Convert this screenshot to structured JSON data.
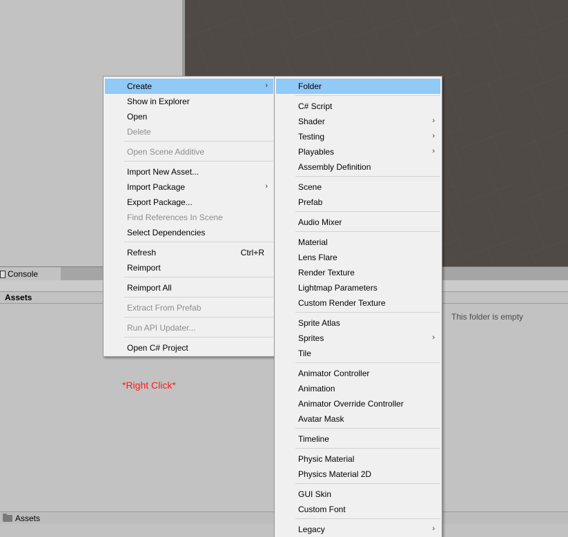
{
  "console_tab": {
    "label": "Console"
  },
  "assets": {
    "header": "Assets",
    "empty_message": "This folder is empty",
    "breadcrumb": "Assets"
  },
  "annotation": "*Right Click*",
  "context_menu": {
    "items": [
      {
        "label": "Create",
        "shortcut": "",
        "submenu": true,
        "disabled": false,
        "highlighted": true
      },
      {
        "label": "Show in Explorer",
        "shortcut": "",
        "submenu": false,
        "disabled": false
      },
      {
        "label": "Open",
        "shortcut": "",
        "submenu": false,
        "disabled": false
      },
      {
        "label": "Delete",
        "shortcut": "",
        "submenu": false,
        "disabled": true
      },
      {
        "label": "Open Scene Additive",
        "shortcut": "",
        "submenu": false,
        "disabled": true
      },
      {
        "label": "Import New Asset...",
        "shortcut": "",
        "submenu": false,
        "disabled": false
      },
      {
        "label": "Import Package",
        "shortcut": "",
        "submenu": true,
        "disabled": false
      },
      {
        "label": "Export Package...",
        "shortcut": "",
        "submenu": false,
        "disabled": false
      },
      {
        "label": "Find References In Scene",
        "shortcut": "",
        "submenu": false,
        "disabled": true
      },
      {
        "label": "Select Dependencies",
        "shortcut": "",
        "submenu": false,
        "disabled": false
      },
      {
        "label": "Refresh",
        "shortcut": "Ctrl+R",
        "submenu": false,
        "disabled": false
      },
      {
        "label": "Reimport",
        "shortcut": "",
        "submenu": false,
        "disabled": false
      },
      {
        "label": "Reimport All",
        "shortcut": "",
        "submenu": false,
        "disabled": false
      },
      {
        "label": "Extract From Prefab",
        "shortcut": "",
        "submenu": false,
        "disabled": true
      },
      {
        "label": "Run API Updater...",
        "shortcut": "",
        "submenu": false,
        "disabled": true
      },
      {
        "label": "Open C# Project",
        "shortcut": "",
        "submenu": false,
        "disabled": false
      }
    ]
  },
  "create_submenu": {
    "items": [
      {
        "label": "Folder",
        "submenu": false,
        "highlighted": true
      },
      {
        "label": "C# Script",
        "submenu": false
      },
      {
        "label": "Shader",
        "submenu": true
      },
      {
        "label": "Testing",
        "submenu": true
      },
      {
        "label": "Playables",
        "submenu": true
      },
      {
        "label": "Assembly Definition",
        "submenu": false
      },
      {
        "label": "Scene",
        "submenu": false
      },
      {
        "label": "Prefab",
        "submenu": false
      },
      {
        "label": "Audio Mixer",
        "submenu": false
      },
      {
        "label": "Material",
        "submenu": false
      },
      {
        "label": "Lens Flare",
        "submenu": false
      },
      {
        "label": "Render Texture",
        "submenu": false
      },
      {
        "label": "Lightmap Parameters",
        "submenu": false
      },
      {
        "label": "Custom Render Texture",
        "submenu": false
      },
      {
        "label": "Sprite Atlas",
        "submenu": false
      },
      {
        "label": "Sprites",
        "submenu": true
      },
      {
        "label": "Tile",
        "submenu": false
      },
      {
        "label": "Animator Controller",
        "submenu": false
      },
      {
        "label": "Animation",
        "submenu": false
      },
      {
        "label": "Animator Override Controller",
        "submenu": false
      },
      {
        "label": "Avatar Mask",
        "submenu": false
      },
      {
        "label": "Timeline",
        "submenu": false
      },
      {
        "label": "Physic Material",
        "submenu": false
      },
      {
        "label": "Physics Material 2D",
        "submenu": false
      },
      {
        "label": "GUI Skin",
        "submenu": false
      },
      {
        "label": "Custom Font",
        "submenu": false
      },
      {
        "label": "Legacy",
        "submenu": true
      }
    ]
  },
  "colors": {
    "highlight": "#91c9f7",
    "annotation": "#ff1a1a",
    "disabled_text": "#8d8d8d"
  }
}
